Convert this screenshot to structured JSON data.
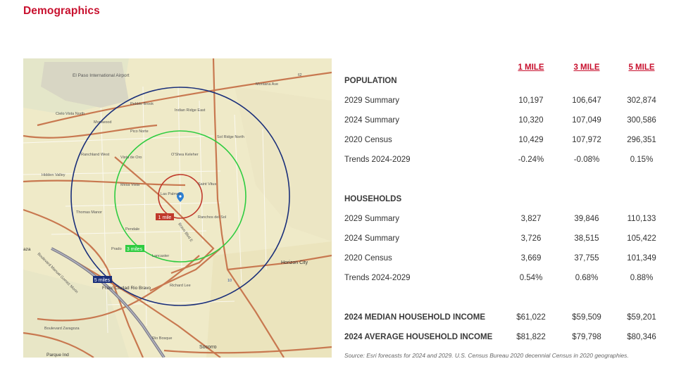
{
  "title": "Demographics",
  "columns": [
    "1 MILE",
    "3 MILE",
    "5 MILE"
  ],
  "population": {
    "heading": "POPULATION",
    "rows": [
      {
        "label": "2029 Summary",
        "values": [
          "10,197",
          "106,647",
          "302,874"
        ]
      },
      {
        "label": "2024 Summary",
        "values": [
          "10,320",
          "107,049",
          "300,586"
        ]
      },
      {
        "label": "2020 Census",
        "values": [
          "10,429",
          "107,972",
          "296,351"
        ]
      },
      {
        "label": "Trends 2024-2029",
        "values": [
          "-0.24%",
          "-0.08%",
          "0.15%"
        ]
      }
    ]
  },
  "households": {
    "heading": "HOUSEHOLDS",
    "rows": [
      {
        "label": "2029 Summary",
        "values": [
          "3,827",
          "39,846",
          "110,133"
        ]
      },
      {
        "label": "2024 Summary",
        "values": [
          "3,726",
          "38,515",
          "105,422"
        ]
      },
      {
        "label": "2020 Census",
        "values": [
          "3,669",
          "37,755",
          "101,349"
        ]
      },
      {
        "label": "Trends 2024-2029",
        "values": [
          "0.54%",
          "0.68%",
          "0.88%"
        ]
      }
    ]
  },
  "income": [
    {
      "label": "2024 MEDIAN HOUSEHOLD INCOME",
      "values": [
        "$61,022",
        "$59,509",
        "$59,201"
      ]
    },
    {
      "label": "2024 AVERAGE HOUSEHOLD INCOME",
      "values": [
        "$81,822",
        "$79,798",
        "$80,346"
      ]
    }
  ],
  "source": "Source: Esri forecasts for 2024 and 2029. U.S. Census Bureau 2020 decennial Census in 2020 geographies.",
  "map": {
    "ring_labels": {
      "one": "1 mile",
      "three": "3 miles",
      "five": "5 miles"
    },
    "ring_colors": {
      "one": "#c0392b",
      "three": "#2ecc40",
      "five": "#1a2f7a"
    },
    "place_labels": [
      "El Paso International Airport",
      "Montana Ave",
      "62",
      "Pebble Brook",
      "Indian Ridge East",
      "Cielo Vista North",
      "Montwood",
      "Pico Norte",
      "Sol Ridge North",
      "Ranchland West",
      "Vista de Oro",
      "O'Shea Keleher",
      "Hidden Valley",
      "Mesa Vista",
      "Saint Vitus",
      "Las Palmas",
      "Thomas Manor",
      "Pendale",
      "Ranchos del Sol",
      "Prado",
      "Lancaster",
      "Horizon City",
      "Fracc Ciudad Rio Bravo",
      "Richard Lee",
      "Boulevard Zaragoza",
      "Socorro",
      "Parque Ind",
      "Rio Bosque",
      "Boulevard Manuel Gomez Morin",
      "10",
      "aza",
      "Bravo Blvd E"
    ]
  }
}
